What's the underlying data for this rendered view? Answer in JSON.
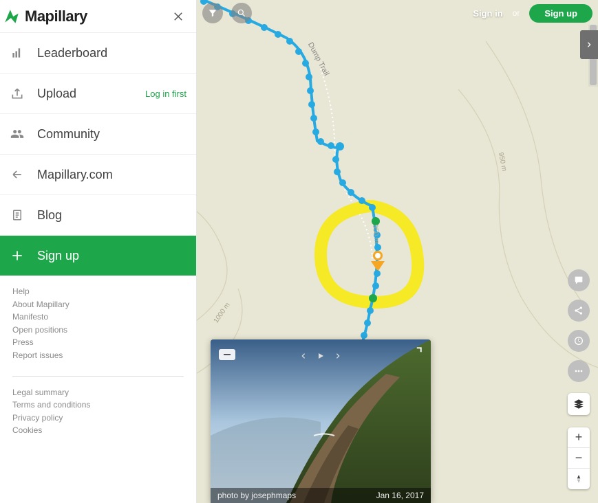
{
  "brand": {
    "name": "Mapillary"
  },
  "sidebar": {
    "items": [
      {
        "label": "Leaderboard"
      },
      {
        "label": "Upload",
        "hint": "Log in first"
      },
      {
        "label": "Community"
      },
      {
        "label": "Mapillary.com"
      },
      {
        "label": "Blog"
      },
      {
        "label": "Sign up"
      }
    ]
  },
  "footer": {
    "group1": [
      "Help",
      "About Mapillary",
      "Manifesto",
      "Open positions",
      "Press",
      "Report issues"
    ],
    "group2": [
      "Legal summary",
      "Terms and conditions",
      "Privacy policy",
      "Cookies"
    ]
  },
  "topbar": {
    "signin": "Sign in",
    "or": "or",
    "signup": "Sign up"
  },
  "map": {
    "trail_label": "Dump Trail",
    "contours": {
      "c1": "950 m",
      "c2": "1000 m",
      "c3": "950 m"
    }
  },
  "photo": {
    "byline": "photo by josephmaps",
    "date": "Jan 16, 2017"
  },
  "zoom": {
    "in": "+",
    "out": "−"
  },
  "colors": {
    "accent": "#1ea64b",
    "map_bg": "#e8e6d4",
    "track": "#27a9e1",
    "highlight": "#f6e926"
  }
}
